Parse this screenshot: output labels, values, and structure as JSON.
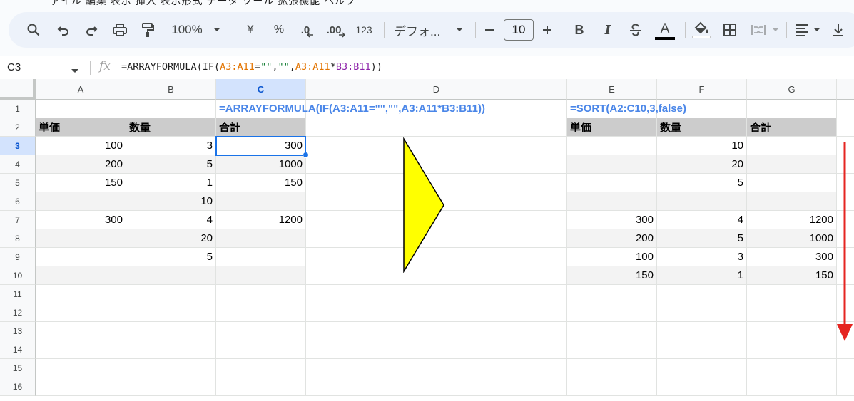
{
  "menu": {
    "ghost_text": "ァイル 編集 表示 挿入 表示形式 データ ツール 拡張機能 ヘルプ"
  },
  "toolbar": {
    "zoom": "100%",
    "currency_symbol": "¥",
    "percent_symbol": "%",
    "decrease_decimal": ".0",
    "increase_decimal": ".00",
    "number_format": "123",
    "font_name": "デフォ...",
    "font_size": "10",
    "bold": "B",
    "italic": "I",
    "text_color_letter": "A",
    "icons": [
      "search-icon",
      "undo-icon",
      "redo-icon",
      "print-icon",
      "paint-format-icon",
      "chevron-down-icon",
      "minus-icon",
      "plus-icon",
      "strikethrough-icon",
      "fill-color-icon",
      "borders-icon",
      "merge-cells-icon",
      "align-icon",
      "download-icon"
    ]
  },
  "formula_bar": {
    "name_box": "C3",
    "fx": "fx",
    "formula_parts": [
      "=ARRAYFORMULA(IF(",
      "A3:A11",
      "=",
      "\"\"",
      ",",
      "\"\"",
      ",",
      "A3:A11",
      "*",
      "B3:B11",
      "))"
    ]
  },
  "sheet": {
    "columns": [
      "A",
      "B",
      "C",
      "D",
      "E",
      "F",
      "G"
    ],
    "rows": [
      "1",
      "2",
      "3",
      "4",
      "5",
      "6",
      "7",
      "8",
      "9",
      "10",
      "11",
      "12",
      "13",
      "14",
      "15",
      "16"
    ],
    "active_cell": "C3",
    "formula_labels": {
      "c1": "=ARRAYFORMULA(IF(A3:A11=\"\",\"\",A3:A11*B3:B11))",
      "e1": "=SORT(A2:C10,3,false)"
    },
    "left_table": {
      "headers": [
        "単価",
        "数量",
        "合計"
      ],
      "rows": [
        [
          "100",
          "3",
          "300"
        ],
        [
          "200",
          "5",
          "1000"
        ],
        [
          "150",
          "1",
          "150"
        ],
        [
          "",
          "10",
          ""
        ],
        [
          "300",
          "4",
          "1200"
        ],
        [
          "",
          "20",
          ""
        ],
        [
          "",
          "5",
          ""
        ],
        [
          "",
          "",
          ""
        ]
      ]
    },
    "right_table": {
      "headers": [
        "単価",
        "数量",
        "合計"
      ],
      "rows": [
        [
          "",
          "10",
          ""
        ],
        [
          "",
          "20",
          ""
        ],
        [
          "",
          "5",
          ""
        ],
        [
          "",
          "",
          ""
        ],
        [
          "300",
          "4",
          "1200"
        ],
        [
          "200",
          "5",
          "1000"
        ],
        [
          "100",
          "3",
          "300"
        ],
        [
          "150",
          "1",
          "150"
        ]
      ]
    }
  },
  "annotations": {
    "triangle_color": "#ffff00",
    "arrow_color": "#e52521"
  }
}
